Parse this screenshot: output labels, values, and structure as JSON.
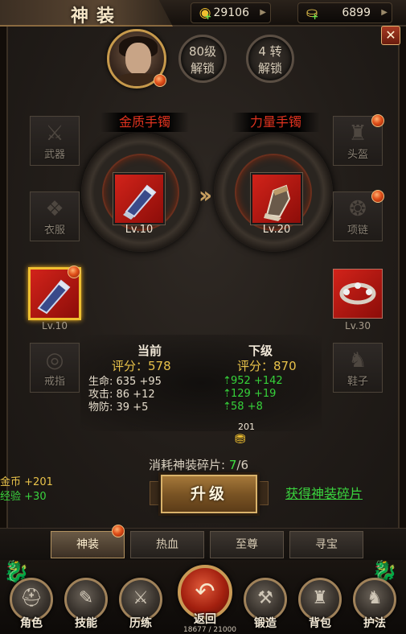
{
  "header": {
    "title": "神装"
  },
  "currencies": [
    {
      "icon": "gold-ingot-icon",
      "value": "29106"
    },
    {
      "icon": "yuanbao-icon",
      "value": "6899"
    }
  ],
  "unlocks": [
    {
      "line1": "80级",
      "line2": "解锁"
    },
    {
      "line1": "4 转",
      "line2": "解锁"
    }
  ],
  "compare": {
    "current": {
      "name": "金质手镯",
      "level": "Lv.10"
    },
    "next": {
      "name": "力量手镯",
      "level": "Lv.20"
    }
  },
  "left_slots": [
    {
      "label": "武器",
      "glyph": "⚔"
    },
    {
      "label": "衣服",
      "glyph": "❖"
    },
    {
      "label": "",
      "glyph": "",
      "level": "Lv.10"
    },
    {
      "label": "戒指",
      "glyph": "◎"
    }
  ],
  "right_slots": [
    {
      "label": "头盔",
      "glyph": "♜"
    },
    {
      "label": "项链",
      "glyph": "❂"
    },
    {
      "label": "",
      "glyph": "",
      "level": "Lv.30"
    },
    {
      "label": "鞋子",
      "glyph": "♞"
    }
  ],
  "stats": {
    "current_title": "当前",
    "next_title": "下级",
    "current_score": "评分：578",
    "next_score": "评分：870",
    "current_lines": [
      "生命: 635 +95",
      "攻击: 86 +12",
      "物防: 39 +5"
    ],
    "next_lines": [
      "952 +142",
      "129 +19",
      "58 +8"
    ]
  },
  "gold_cost": "201",
  "cost": {
    "label": "消耗神装碎片:",
    "have": "7",
    "need": "/6"
  },
  "upgrade_label": "升级",
  "get_fragments_label": "获得神装碎片",
  "rewards": [
    {
      "key": "金币",
      "value": "+201"
    },
    {
      "key": "经验",
      "value": "+30"
    }
  ],
  "tabs": [
    "神装",
    "热血",
    "至尊",
    "寻宝"
  ],
  "nav": [
    "角色",
    "技能",
    "历练",
    "返回",
    "锻造",
    "背包",
    "护法"
  ],
  "exp_text": "18677 / 21000"
}
